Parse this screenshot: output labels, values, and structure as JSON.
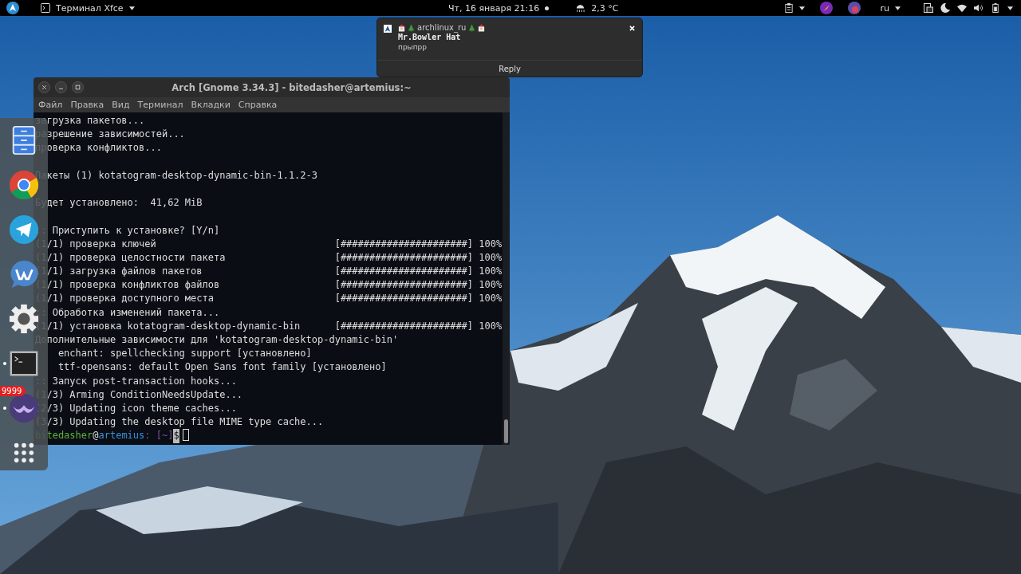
{
  "top_bar": {
    "app_menu": "Терминал Xfce",
    "clock": "Чт, 16 января  21:16",
    "weather": "2,3 °C",
    "keyboard_layout": "ru"
  },
  "notification": {
    "app": "archlinux_ru",
    "sender": "Mr.Bowler Hat",
    "message": "прыпрр",
    "action": "Reply"
  },
  "terminal": {
    "title": "Arch [Gnome 3.34.3] - bitedasher@artemius:~",
    "menu": [
      "Файл",
      "Правка",
      "Вид",
      "Терминал",
      "Вкладки",
      "Справка"
    ],
    "lines": [
      {
        "kind": "text",
        "text": "загрузка пакетов..."
      },
      {
        "kind": "text",
        "text": "разрешение зависимостей..."
      },
      {
        "kind": "text",
        "text": "проверка конфликтов..."
      },
      {
        "kind": "blank"
      },
      {
        "kind": "text",
        "text": "Пакеты (1) kotatogram-desktop-dynamic-bin-1.1.2-3"
      },
      {
        "kind": "blank"
      },
      {
        "kind": "text",
        "text": "Будет установлено:  41,62 MiB"
      },
      {
        "kind": "blank"
      },
      {
        "kind": "text",
        "text": ":: Приступить к установке? [Y/n]"
      },
      {
        "kind": "progress",
        "text": "(1/1) проверка ключей",
        "bar": "[######################]",
        "percent": "100%"
      },
      {
        "kind": "progress",
        "text": "(1/1) проверка целостности пакета",
        "bar": "[######################]",
        "percent": "100%"
      },
      {
        "kind": "progress",
        "text": "(1/1) загрузка файлов пакетов",
        "bar": "[######################]",
        "percent": "100%"
      },
      {
        "kind": "progress",
        "text": "(1/1) проверка конфликтов файлов",
        "bar": "[######################]",
        "percent": "100%"
      },
      {
        "kind": "progress",
        "text": "(1/1) проверка доступного места",
        "bar": "[######################]",
        "percent": "100%"
      },
      {
        "kind": "text",
        "text": ":: Обработка изменений пакета..."
      },
      {
        "kind": "progress",
        "text": "(1/1) установка kotatogram-desktop-dynamic-bin",
        "bar": "[######################]",
        "percent": "100%"
      },
      {
        "kind": "text",
        "text": "Дополнительные зависимости для 'kotatogram-desktop-dynamic-bin'"
      },
      {
        "kind": "text",
        "text": "    enchant: spellchecking support [установлено]"
      },
      {
        "kind": "text",
        "text": "    ttf-opensans: default Open Sans font family [установлено]"
      },
      {
        "kind": "text",
        "text": ":: Запуск post-transaction hooks..."
      },
      {
        "kind": "text",
        "text": "(1/3) Arming ConditionNeedsUpdate..."
      },
      {
        "kind": "text",
        "text": "(2/3) Updating icon theme caches..."
      },
      {
        "kind": "text",
        "text": "(3/3) Updating the desktop file MIME type cache..."
      },
      {
        "kind": "prompt",
        "user": "bitedasher",
        "at": "@",
        "host": "artemius",
        "path": ": [~]",
        "symbol": "$"
      }
    ]
  },
  "dock": {
    "items": [
      {
        "kind": "files",
        "running": false
      },
      {
        "kind": "browser",
        "running": false
      },
      {
        "kind": "plane",
        "running": false
      },
      {
        "kind": "bubble",
        "running": false
      },
      {
        "kind": "settings",
        "running": false
      },
      {
        "kind": "terminal",
        "running": true
      },
      {
        "kind": "app",
        "running": true,
        "badge": "9999"
      },
      {
        "kind": "grid",
        "running": false
      }
    ]
  }
}
